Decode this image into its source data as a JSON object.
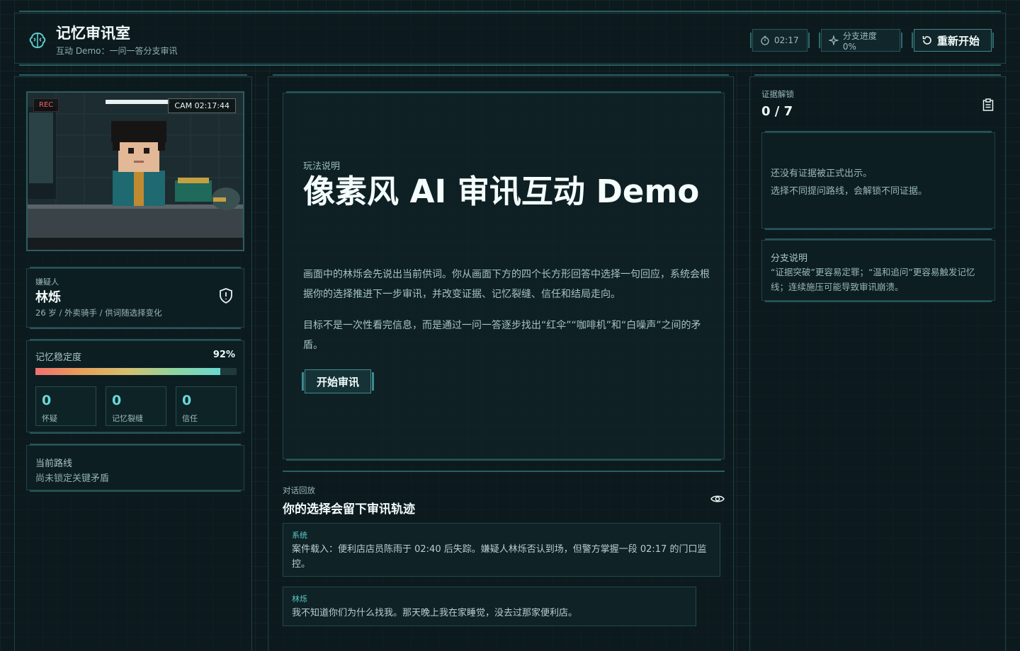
{
  "header": {
    "title": "记忆审讯室",
    "subtitle": "互动 Demo：一问一答分支审讯",
    "timer": "02:17",
    "branch_progress": "分支进度 0%",
    "restart_label": "重新开始"
  },
  "camera": {
    "rec": "REC",
    "cam": "CAM 02:17:44"
  },
  "suspect": {
    "role": "嫌疑人",
    "name": "林烁",
    "info": "26 岁 / 外卖骑手 / 供词随选择变化"
  },
  "stability": {
    "label": "记忆稳定度",
    "value_text": "92%",
    "value": 0.92,
    "stats": [
      {
        "value": "0",
        "label": "怀疑"
      },
      {
        "value": "0",
        "label": "记忆裂缝"
      },
      {
        "value": "0",
        "label": "信任"
      }
    ]
  },
  "route": {
    "label": "当前路线",
    "value": "尚未锁定关键矛盾"
  },
  "intro": {
    "eyebrow": "玩法说明",
    "title": "像素风 AI 审讯互动 Demo",
    "para1": "画面中的林烁会先说出当前供词。你从画面下方的四个长方形回答中选择一句回应，系统会根据你的选择推进下一步审讯，并改变证据、记忆裂缝、信任和结局走向。",
    "para2": "目标不是一次性看完信息，而是通过一问一答逐步找出“红伞”“咖啡机”和“白噪声”之间的矛盾。",
    "start_label": "开始审讯"
  },
  "dialog": {
    "eyebrow": "对话回放",
    "title": "你的选择会留下审讯轨迹",
    "messages": [
      {
        "speaker": "系统",
        "text": "案件载入：便利店店员陈雨于 02:40 后失踪。嫌疑人林烁否认到场，但警方掌握一段 02:17 的门口监控。"
      },
      {
        "speaker": "林烁",
        "text": "我不知道你们为什么找我。那天晚上我在家睡觉，没去过那家便利店。"
      }
    ]
  },
  "evidence": {
    "label": "证据解锁",
    "count": "0 / 7",
    "empty_line1": "还没有证据被正式出示。",
    "empty_line2": "选择不同提问路线，会解锁不同证据。"
  },
  "branch": {
    "label": "分支说明",
    "text": "“证据突破”更容易定罪；“温和追问”更容易触发记忆线；连续施压可能导致审讯崩溃。"
  },
  "colors": {
    "accent": "#5ecaca",
    "background": "#0c191d",
    "rec": "#ff5a5a"
  }
}
